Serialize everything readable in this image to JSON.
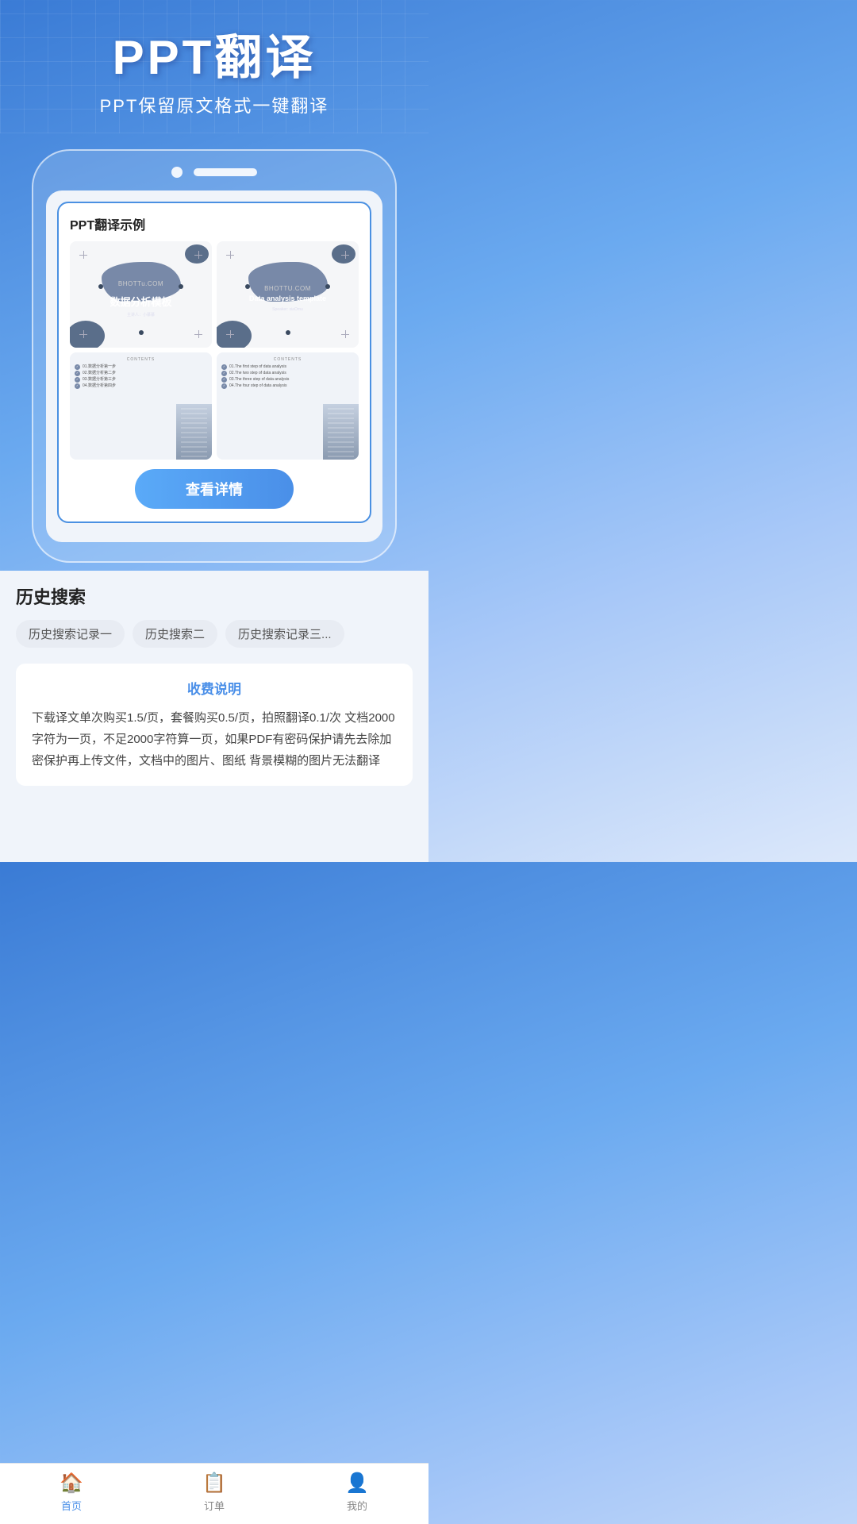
{
  "header": {
    "title": "PPT翻译",
    "subtitle": "PPT保留原文格式一键翻译"
  },
  "phone": {
    "demo_title": "PPT翻译示例",
    "slide1": {
      "main_text": "数据分析模板",
      "sub_text": "主讲人：小慕慕"
    },
    "slide2": {
      "main_text": "Data analysis template",
      "sub_text": "Speaker: xiaOmu"
    },
    "slide3": {
      "header": "CONTENTS",
      "items": [
        "01.数据分析第一步",
        "02.数据分析第二步",
        "03.数据分析第三步",
        "04.数据分析第四步"
      ]
    },
    "slide4": {
      "header": "CONTENTS",
      "items": [
        "01.The first step of data analysis",
        "02.The two step of data analysis",
        "03.The three step of data analysis",
        "04.The four step of data analysis"
      ]
    },
    "view_btn": "查看详情"
  },
  "history": {
    "title": "历史搜索",
    "tags": [
      "历史搜索记录一",
      "历史搜索二",
      "历史搜索记录三..."
    ]
  },
  "pricing": {
    "title": "收费说明",
    "text": "下载译文单次购买1.5/页，套餐购买0.5/页，拍照翻译0.1/次 文档2000字符为一页，不足2000字符算一页，如果PDF有密码保护请先去除加密保护再上传文件，文档中的图片、图纸 背景模糊的图片无法翻译"
  },
  "nav": {
    "items": [
      {
        "label": "首页",
        "icon": "🏠",
        "active": true
      },
      {
        "label": "订单",
        "icon": "📋",
        "active": false
      },
      {
        "label": "我的",
        "icon": "👤",
        "active": false
      }
    ]
  }
}
